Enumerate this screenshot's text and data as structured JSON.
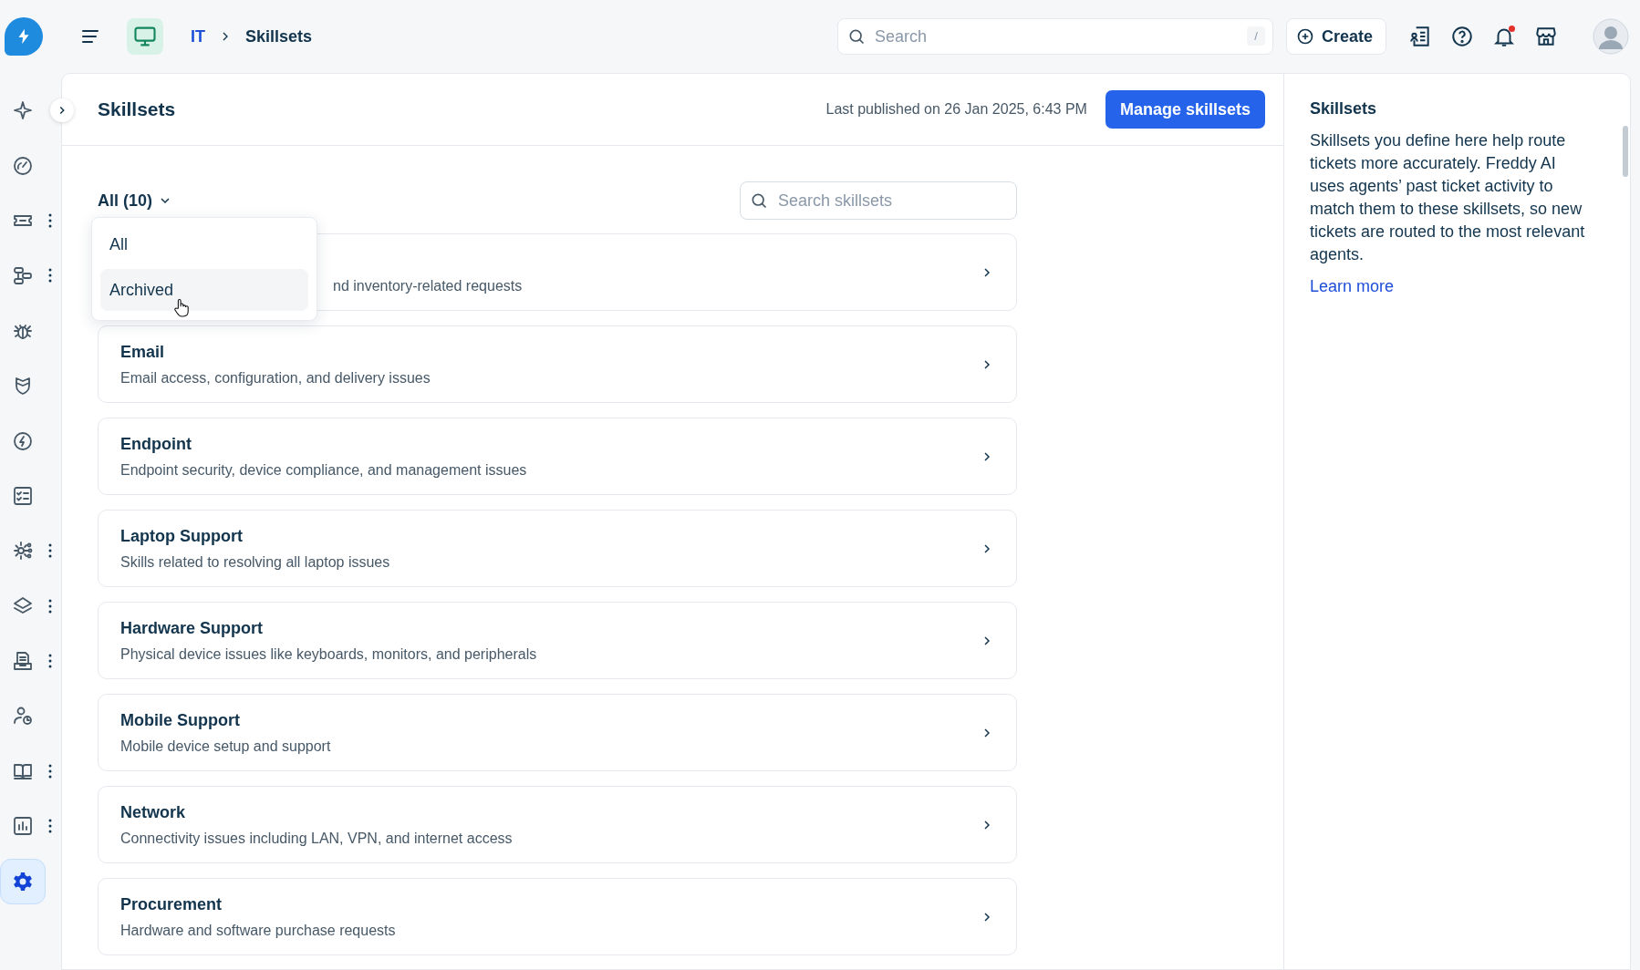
{
  "topbar": {
    "breadcrumb": [
      {
        "label": "IT",
        "link": true
      },
      {
        "label": "Skillsets",
        "link": false
      }
    ],
    "search": {
      "placeholder": "Search",
      "shortcut": "/"
    },
    "create_button": "Create",
    "notifications": {
      "unread": true
    }
  },
  "sidebar": {
    "items": [
      {
        "menu": false,
        "selected": false
      },
      {
        "menu": false,
        "selected": false
      },
      {
        "menu": true,
        "selected": false
      },
      {
        "menu": true,
        "selected": false
      },
      {
        "menu": false,
        "selected": false
      },
      {
        "menu": false,
        "selected": false
      },
      {
        "menu": false,
        "selected": false
      },
      {
        "menu": false,
        "selected": false
      },
      {
        "menu": true,
        "selected": false
      },
      {
        "menu": true,
        "selected": false
      },
      {
        "menu": true,
        "selected": false
      },
      {
        "menu": false,
        "selected": false
      },
      {
        "menu": true,
        "selected": false
      },
      {
        "menu": true,
        "selected": false
      },
      {
        "menu": false,
        "selected": true
      }
    ]
  },
  "page": {
    "title": "Skillsets",
    "last_published": "Last published on 26 Jan 2025, 6:43 PM",
    "primary_button": "Manage skillsets"
  },
  "filter": {
    "label": "All (10)",
    "expanded": true,
    "options": [
      {
        "label": "All",
        "selected": false
      },
      {
        "label": "Archived",
        "selected": true
      }
    ]
  },
  "search": {
    "placeholder": "Search skillsets"
  },
  "skillsets": [
    {
      "description": "nd inventory-related requests"
    },
    {
      "name": "Email",
      "description": "Email access, configuration, and delivery issues"
    },
    {
      "name": "Endpoint",
      "description": "Endpoint security, device compliance, and management issues"
    },
    {
      "name": "Laptop Support",
      "description": "Skills related to resolving all laptop issues"
    },
    {
      "name": "Hardware Support",
      "description": "Physical device issues like keyboards, monitors, and peripherals"
    },
    {
      "name": "Mobile Support",
      "description": "Mobile device setup and support"
    },
    {
      "name": "Network",
      "description": "Connectivity issues including LAN, VPN, and internet access"
    },
    {
      "name": "Procurement",
      "description": "Hardware and software purchase requests"
    }
  ],
  "help_panel": {
    "title": "Skillsets",
    "body": "Skillsets you define here help route tickets more accurately. Freddy AI uses agents’ past ticket activity to match them to these skillsets, so new tickets are routed to the most relevant agents.",
    "link": "Learn more"
  }
}
